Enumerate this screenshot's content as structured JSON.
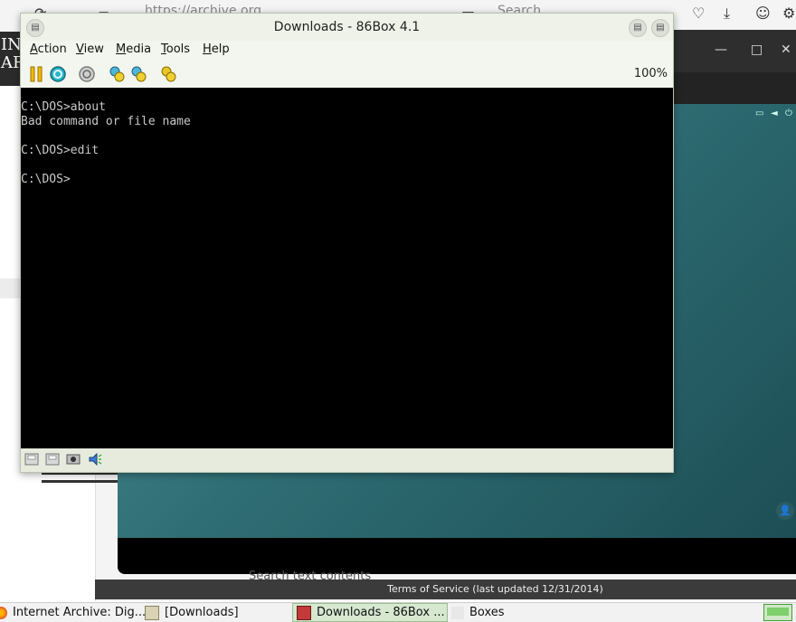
{
  "background_browser": {
    "url": "https://archive.org",
    "search_placeholder": "Search",
    "left_logo_lines": [
      "INT",
      "AR"
    ],
    "search_text_contents": "Search text contents",
    "terms_of_service": "Terms of Service (last updated 12/31/2014)"
  },
  "window": {
    "title": "Downloads - 86Box 4.1",
    "menu": [
      {
        "label": "Action",
        "underline": "A"
      },
      {
        "label": "View",
        "underline": "V"
      },
      {
        "label": "Media",
        "underline": "M"
      },
      {
        "label": "Tools",
        "underline": "T"
      },
      {
        "label": "Help",
        "underline": "H"
      }
    ],
    "toolbar": {
      "icons": [
        "pause-icon",
        "ctrl-alt-del-icon",
        "power-icon",
        "settings-icon",
        "hard-reset-icon",
        "screenshot-icon"
      ],
      "zoom": "100%"
    },
    "console_lines": [
      "C:\\DOS>about",
      "Bad command or file name",
      "",
      "C:\\DOS>edit",
      "",
      "C:\\DOS>"
    ],
    "statusbar_icons": [
      "floppy-a-icon",
      "floppy-b-icon",
      "network-icon",
      "sound-icon"
    ]
  },
  "taskbar": {
    "tasks": [
      {
        "label": "Internet Archive: Dig...",
        "icon": "firefox-icon",
        "active": false
      },
      {
        "label": "[Downloads]",
        "icon": "folder-icon",
        "active": false
      },
      {
        "label": "Downloads - 86Box ...",
        "icon": "86box-icon",
        "active": true
      },
      {
        "label": "Boxes",
        "icon": "boxes-icon",
        "active": false
      }
    ]
  },
  "colors": {
    "console_text": "#c8c8c8",
    "console_bg": "#000000",
    "window_chrome": "#f3f6ee",
    "teal_video": "#2f6e75"
  }
}
